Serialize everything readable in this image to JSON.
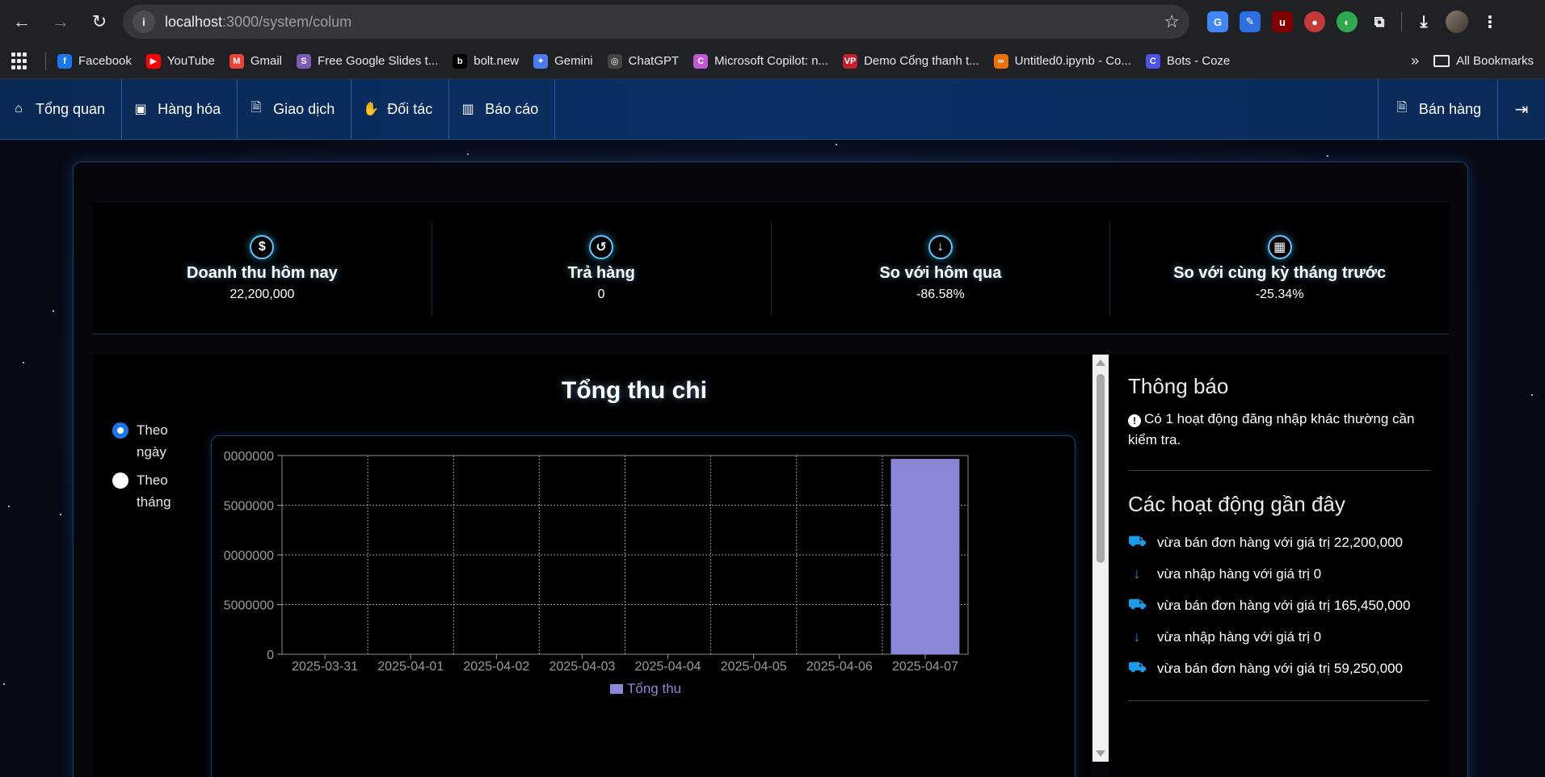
{
  "browser": {
    "url_host": "localhost",
    "url_path": ":3000/system/colum",
    "bookmarks": [
      {
        "label": "Facebook",
        "icon": "facebook-icon",
        "color": "#1877f2",
        "glyph": "f"
      },
      {
        "label": "YouTube",
        "icon": "youtube-icon",
        "color": "#ff0000",
        "glyph": "▶"
      },
      {
        "label": "Gmail",
        "icon": "gmail-icon",
        "color": "#ea4335",
        "glyph": "M"
      },
      {
        "label": "Free Google Slides t...",
        "icon": "slides-icon",
        "color": "#7b5bb5",
        "glyph": "S"
      },
      {
        "label": "bolt.new",
        "icon": "bolt-icon",
        "color": "#000000",
        "glyph": "b"
      },
      {
        "label": "Gemini",
        "icon": "gemini-icon",
        "color": "#4a7cf0",
        "glyph": "✦"
      },
      {
        "label": "ChatGPT",
        "icon": "chatgpt-icon",
        "color": "#444444",
        "glyph": "◎"
      },
      {
        "label": "Microsoft Copilot: n...",
        "icon": "copilot-icon",
        "color": "#c15ad1",
        "glyph": "C"
      },
      {
        "label": "Demo Cổng thanh t...",
        "icon": "vp-icon",
        "color": "#c4202b",
        "glyph": "VP"
      },
      {
        "label": "Untitled0.ipynb - Co...",
        "icon": "colab-icon",
        "color": "#e8710a",
        "glyph": "∞"
      },
      {
        "label": "Bots - Coze",
        "icon": "coze-icon",
        "color": "#4d53e8",
        "glyph": "C"
      }
    ],
    "all_bookmarks": "All Bookmarks"
  },
  "nav": {
    "items": [
      {
        "label": "Tổng quan",
        "icon": "home-icon"
      },
      {
        "label": "Hàng hóa",
        "icon": "box-icon"
      },
      {
        "label": "Giao dịch",
        "icon": "document-icon"
      },
      {
        "label": "Đối tác",
        "icon": "handshake-icon"
      },
      {
        "label": "Báo cáo",
        "icon": "chart-icon"
      }
    ],
    "sell_label": "Bán hàng"
  },
  "stats": [
    {
      "title": "Doanh thu hôm nay",
      "value": "22,200,000",
      "icon": "dollar-icon"
    },
    {
      "title": "Trả hàng",
      "value": "0",
      "icon": "undo-icon"
    },
    {
      "title": "So với hôm qua",
      "value": "-86.58%",
      "icon": "arrow-down-circle-icon"
    },
    {
      "title": "So với cùng kỳ tháng trước",
      "value": "-25.34%",
      "icon": "calendar-icon"
    }
  ],
  "filters": {
    "by_day": "Theo ngày",
    "by_month": "Theo tháng",
    "selected": "by_day"
  },
  "chart_data": {
    "type": "bar",
    "title": "Tổng thu chi",
    "categories": [
      "2025-03-31",
      "2025-04-01",
      "2025-04-02",
      "2025-04-03",
      "2025-04-04",
      "2025-04-05",
      "2025-04-06",
      "2025-04-07"
    ],
    "series": [
      {
        "name": "Tổng thu",
        "color": "#8a86d8",
        "values": [
          0,
          0,
          0,
          0,
          0,
          0,
          0,
          29500000
        ]
      }
    ],
    "yticks": [
      "0",
      "5000000",
      "0000000",
      "5000000",
      "0000000"
    ],
    "ylim": [
      0,
      30000000
    ],
    "grid": true,
    "legend": "bottom"
  },
  "notifications": {
    "title": "Thông báo",
    "alert": "Có 1 hoạt động đăng nhập khác thường cần kiểm tra."
  },
  "activities": {
    "title": "Các hoạt động gần đây",
    "items": [
      {
        "text": "vừa bán đơn hàng với giá trị 22,200,000",
        "icon": "cart-icon"
      },
      {
        "text": "vừa nhập hàng với giá trị 0",
        "icon": "arrow-down-icon"
      },
      {
        "text": "vừa bán đơn hàng với giá trị 165,450,000",
        "icon": "cart-icon"
      },
      {
        "text": "vừa nhập hàng với giá trị 0",
        "icon": "arrow-down-icon"
      },
      {
        "text": "vừa bán đơn hàng với giá trị 59,250,000",
        "icon": "cart-icon"
      }
    ]
  }
}
